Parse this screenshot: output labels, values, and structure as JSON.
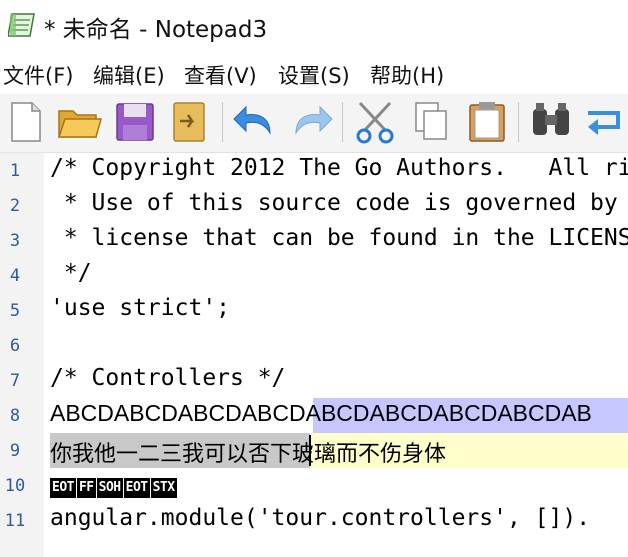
{
  "window": {
    "title": "* 未命名 - Notepad3",
    "icon": "notepad-icon"
  },
  "menu": {
    "file": "文件(F)",
    "edit": "编辑(E)",
    "view": "查看(V)",
    "settings": "设置(S)",
    "help": "帮助(H)"
  },
  "toolbar": {
    "buttons": [
      {
        "name": "new-file-icon"
      },
      {
        "name": "open-folder-icon"
      },
      {
        "name": "save-icon"
      },
      {
        "name": "save-as-icon"
      },
      {
        "name": "undo-icon"
      },
      {
        "name": "redo-icon"
      },
      {
        "name": "cut-icon"
      },
      {
        "name": "copy-icon"
      },
      {
        "name": "paste-icon"
      },
      {
        "name": "find-icon"
      },
      {
        "name": "replace-icon"
      }
    ]
  },
  "editor": {
    "line_numbers": [
      "1",
      "2",
      "3",
      "4",
      "5",
      "6",
      "7",
      "8",
      "9",
      "10",
      "11"
    ],
    "lines": {
      "l1": "/* Copyright 2012 The Go Authors.   All ri",
      "l2": " * Use of this source code is governed by",
      "l3": " * license that can be found in the LICENS",
      "l4": " */",
      "l5": "'use strict';",
      "l6": "",
      "l7": "/* Controllers */",
      "l8a": "ABCDABCDABCDABCDABC",
      "l8b": "DABCDABCDABCDAB",
      "l9a": "你我他一二三我可以否",
      "l9b": "下玻璃而不伤身体",
      "l10": [
        "EOT",
        "FF",
        "SOH",
        "EOT",
        "STX"
      ],
      "l11": "angular.module('tour.controllers', [])."
    },
    "colors": {
      "selection": "#c7c7ff",
      "inactive_selection": "#c8c8c8",
      "current_line": "#ffffcc",
      "line_number": "#2f5a9b",
      "gutter": "#f3f3f3"
    }
  }
}
